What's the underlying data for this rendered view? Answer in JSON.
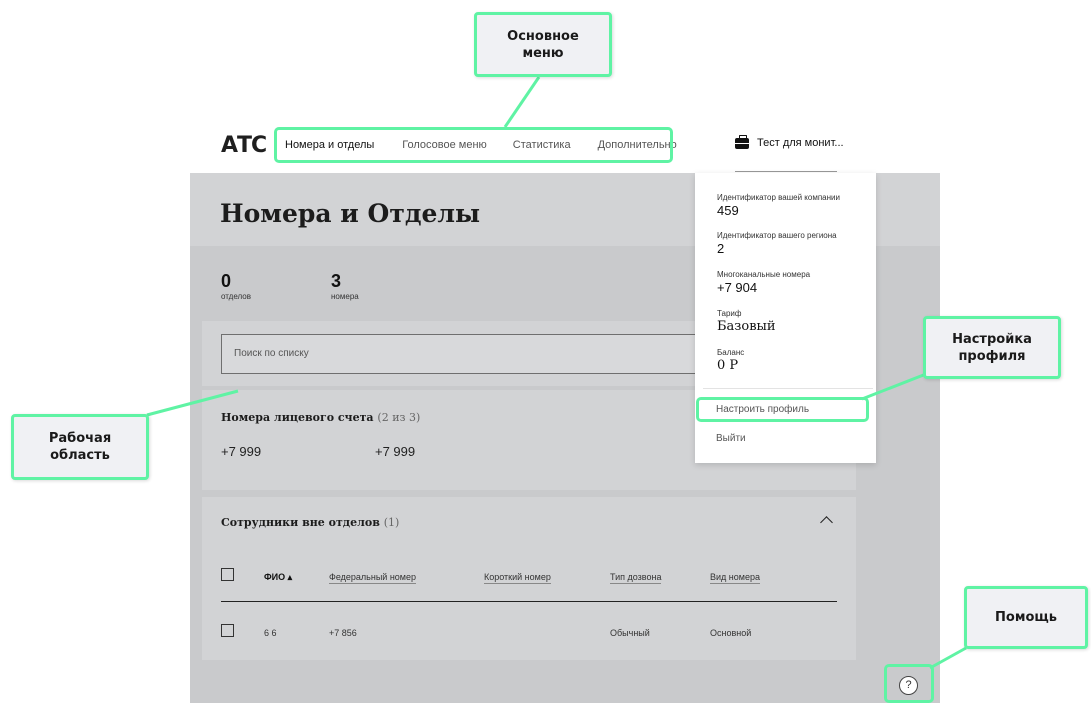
{
  "app": {
    "logo": "АТС",
    "nav": [
      "Номера и отделы",
      "Голосовое меню",
      "Статистика",
      "Дополнительно"
    ],
    "profile_name": "Тест для монит..."
  },
  "page": {
    "title": "Номера и Отделы",
    "stats": [
      {
        "value": "0",
        "label": "отделов"
      },
      {
        "value": "3",
        "label": "номера"
      }
    ],
    "search_placeholder": "Поиск по списку",
    "account_section": {
      "title": "Номера лицевого счета",
      "count": "(2 из 3)",
      "phones": [
        "+7 999",
        "+7 999"
      ]
    },
    "employees_section": {
      "title": "Сотрудники вне отделов",
      "count": "(1)",
      "columns": [
        "ФИО ▴",
        "Федеральный номер",
        "Короткий номер",
        "Тип дозвона",
        "Вид номера"
      ],
      "rows": [
        {
          "name": "6 6",
          "federal": "+7 856",
          "short": "",
          "dial_type": "Обычный",
          "number_type": "Основной"
        }
      ]
    }
  },
  "dropdown": {
    "items": [
      {
        "label": "Идентификатор вашей компании",
        "value": "459"
      },
      {
        "label": "Идентификатор вашего региона",
        "value": "2"
      },
      {
        "label": "Многоканальные номера",
        "value": "+7 904"
      },
      {
        "label": "Тариф",
        "value": "Базовый"
      },
      {
        "label": "Баланс",
        "value": "0 Р"
      }
    ],
    "configure_profile": "Настроить профиль",
    "logout": "Выйти"
  },
  "help": {
    "symbol": "?"
  },
  "annotations": {
    "main_menu": "Основное меню",
    "profile_settings": "Настройка профиля",
    "work_area": "Рабочая область",
    "help": "Помощь"
  },
  "colors": {
    "annotation_border": "#5ff3a4",
    "workspace_bg": "#c9cacc",
    "card_bg": "#d2d3d5"
  }
}
